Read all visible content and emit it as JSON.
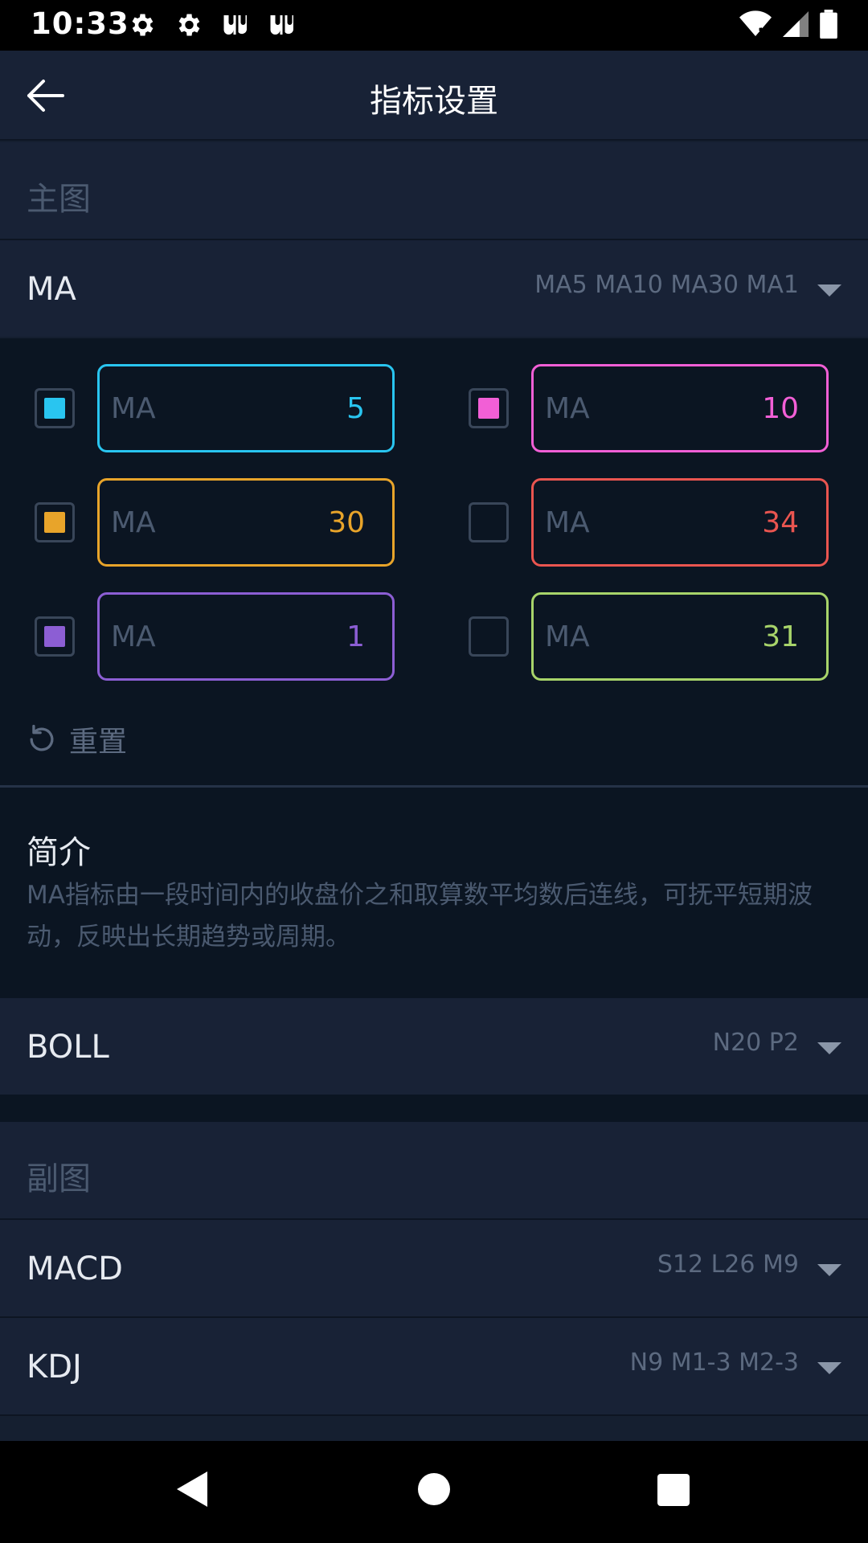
{
  "status_bar": {
    "time": "10:33",
    "left_icons": [
      "gear-icon",
      "gear-icon",
      "app-icon",
      "app-icon"
    ],
    "right_icons": [
      "wifi-icon",
      "signal-icon",
      "battery-icon"
    ]
  },
  "header": {
    "title": "指标设置",
    "back_icon": "arrow-left-icon"
  },
  "main_chart": {
    "section_title": "主图",
    "indicators": [
      {
        "name": "MA",
        "params": "MA5 MA10 MA30 MA1",
        "expanded": true,
        "lines": [
          {
            "label": "MA",
            "value": "5",
            "checked": true,
            "color": "#29c5f0"
          },
          {
            "label": "MA",
            "value": "10",
            "checked": true,
            "color": "#f25fd6"
          },
          {
            "label": "MA",
            "value": "30",
            "checked": true,
            "color": "#e8a42a"
          },
          {
            "label": "MA",
            "value": "34",
            "checked": false,
            "color": "#ea5550"
          },
          {
            "label": "MA",
            "value": "1",
            "checked": true,
            "color": "#8c5ed4"
          },
          {
            "label": "MA",
            "value": "31",
            "checked": false,
            "color": "#a8d46a"
          }
        ],
        "reset_label": "重置",
        "intro_title": "简介",
        "intro_text": "MA指标由一段时间内的收盘价之和取算数平均数后连线，可抚平短期波动，反映出长期趋势或周期。"
      },
      {
        "name": "BOLL",
        "params": "N20 P2",
        "expanded": false
      }
    ]
  },
  "sub_chart": {
    "section_title": "副图",
    "indicators": [
      {
        "name": "MACD",
        "params": "S12 L26 M9"
      },
      {
        "name": "KDJ",
        "params": "N9 M1-3 M2-3"
      }
    ]
  },
  "nav_bar": {
    "buttons": [
      "back-triangle-icon",
      "home-circle-icon",
      "recents-square-icon"
    ]
  }
}
